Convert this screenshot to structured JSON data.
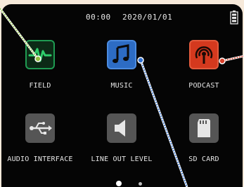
{
  "status": {
    "time": "00:00",
    "date": "2020/01/01"
  },
  "apps": [
    {
      "label": "FIELD",
      "color": "#1f9b52",
      "icon": "waveform-icon"
    },
    {
      "label": "MUSIC",
      "color": "#2d6cc4",
      "icon": "music-note-icon"
    },
    {
      "label": "PODCAST",
      "color": "#d4391e",
      "icon": "podcast-microphone-icon"
    },
    {
      "label": "AUDIO INTERFACE",
      "color": "#555555",
      "icon": "usb-icon"
    },
    {
      "label": "LINE OUT LEVEL",
      "color": "#555555",
      "icon": "speaker-icon"
    },
    {
      "label": "SD CARD",
      "color": "#555555",
      "icon": "sd-card-icon"
    }
  ],
  "pager": {
    "pages": 2,
    "current": 1
  },
  "callout_colors": {
    "field": "#8fbf3f",
    "music": "#2f6fcf",
    "podcast": "#d9402a"
  }
}
